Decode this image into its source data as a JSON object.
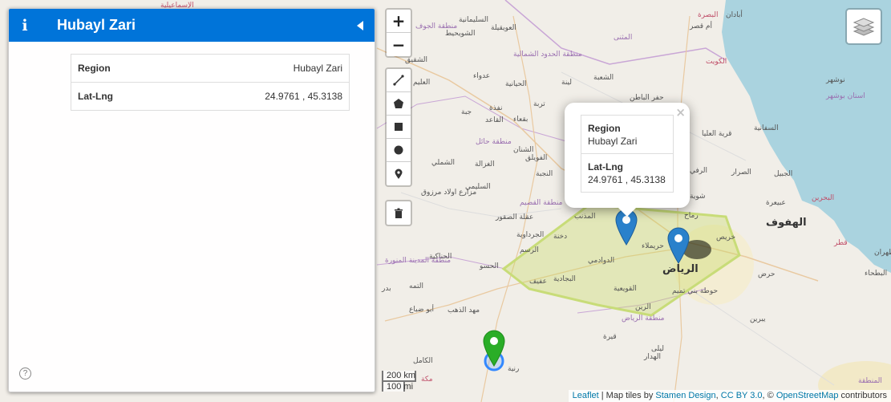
{
  "sidebar": {
    "title": "Hubayl Zari",
    "rows": [
      {
        "key": "Region",
        "value": "Hubayl Zari"
      },
      {
        "key": "Lat-Lng",
        "value": "24.9761 , 45.3138"
      }
    ],
    "help_glyph": "?",
    "info_glyph": "i"
  },
  "zoom": {
    "in": "+",
    "out": "−"
  },
  "draw_tools": [
    "polyline-icon",
    "polygon-icon",
    "rectangle-icon",
    "circle-icon",
    "marker-icon"
  ],
  "popup": {
    "close": "×",
    "rows": [
      {
        "key": "Region",
        "value": "Hubayl Zari"
      },
      {
        "key": "Lat-Lng",
        "value": "24.9761 , 45.3138"
      }
    ]
  },
  "scale": {
    "km": "200 km",
    "mi": "100 mi"
  },
  "attribution": {
    "leaflet": "Leaflet",
    "sep1": " | Map tiles by ",
    "stamen": "Stamen Design",
    "sep2": ", ",
    "cc": "CC BY 3.0",
    "sep3": ", © ",
    "osm": "OpenStreetMap",
    "sep4": " contributors"
  },
  "places": [
    {
      "name": "الإسماعيلية",
      "style": "red"
    },
    {
      "name": "الكويت",
      "style": "red"
    },
    {
      "name": "البصرة",
      "style": "red"
    },
    {
      "name": "المثنى",
      "style": "purple"
    },
    {
      "name": "منطقة الحدود الشمالية",
      "style": "purple"
    },
    {
      "name": "السليمانية",
      "style": ""
    },
    {
      "name": "الشويحيط",
      "style": ""
    },
    {
      "name": "العويقيلة",
      "style": ""
    },
    {
      "name": "منطقة الجوف",
      "style": "purple"
    },
    {
      "name": "الشقيق",
      "style": ""
    },
    {
      "name": "عدواء",
      "style": ""
    },
    {
      "name": "العليم",
      "style": ""
    },
    {
      "name": "الحيانية",
      "style": ""
    },
    {
      "name": "لينة",
      "style": ""
    },
    {
      "name": "الشعبة",
      "style": ""
    },
    {
      "name": "حفر الباطن",
      "style": ""
    },
    {
      "name": "نفذة",
      "style": ""
    },
    {
      "name": "تربة",
      "style": ""
    },
    {
      "name": "جبة",
      "style": ""
    },
    {
      "name": "بقعاء",
      "style": ""
    },
    {
      "name": "القاعد",
      "style": ""
    },
    {
      "name": "منطقة حائل",
      "style": "purple"
    },
    {
      "name": "الشنان",
      "style": ""
    },
    {
      "name": "الشملي",
      "style": ""
    },
    {
      "name": "الغزالة",
      "style": ""
    },
    {
      "name": "الفويلق",
      "style": ""
    },
    {
      "name": "النجبة",
      "style": ""
    },
    {
      "name": "السليمي",
      "style": ""
    },
    {
      "name": "مزارع اولاد مرزوق",
      "style": ""
    },
    {
      "name": "منطقة القصيم",
      "style": "purple"
    },
    {
      "name": "عقلة الصقور",
      "style": ""
    },
    {
      "name": "المذنب",
      "style": ""
    },
    {
      "name": "الجرداوية",
      "style": ""
    },
    {
      "name": "دخنة",
      "style": ""
    },
    {
      "name": "الرسم",
      "style": ""
    },
    {
      "name": "الحناكية",
      "style": ""
    },
    {
      "name": "الدوادمي",
      "style": ""
    },
    {
      "name": "الحسو",
      "style": ""
    },
    {
      "name": "البجادية",
      "style": ""
    },
    {
      "name": "عفيف",
      "style": ""
    },
    {
      "name": "منطقة المدينة المنورة",
      "style": "purple"
    },
    {
      "name": "التمه",
      "style": ""
    },
    {
      "name": "بدر",
      "style": ""
    },
    {
      "name": "مهد الذهب",
      "style": ""
    },
    {
      "name": "أبو ضباع",
      "style": ""
    },
    {
      "name": "القويعية",
      "style": ""
    },
    {
      "name": "الرين",
      "style": ""
    },
    {
      "name": "منطقة الرياض",
      "style": "purple"
    },
    {
      "name": "الرياض",
      "style": "big"
    },
    {
      "name": "حريملاء",
      "style": ""
    },
    {
      "name": "حوطة بني تميم",
      "style": ""
    },
    {
      "name": "مكة",
      "style": "red"
    },
    {
      "name": "الكامل",
      "style": ""
    },
    {
      "name": "رنية",
      "style": ""
    },
    {
      "name": "قيرة",
      "style": ""
    },
    {
      "name": "ليلى",
      "style": ""
    },
    {
      "name": "الهدار",
      "style": ""
    },
    {
      "name": "يبرين",
      "style": ""
    },
    {
      "name": "حرض",
      "style": ""
    },
    {
      "name": "البطحاء",
      "style": ""
    },
    {
      "name": "خريص",
      "style": ""
    },
    {
      "name": "الهفوف",
      "style": "big"
    },
    {
      "name": "البحرين",
      "style": "red"
    },
    {
      "name": "قطر",
      "style": "red"
    },
    {
      "name": "الظهران",
      "style": ""
    },
    {
      "name": "الجبيل",
      "style": ""
    },
    {
      "name": "الصرار",
      "style": ""
    },
    {
      "name": "السفانية",
      "style": ""
    },
    {
      "name": "قرية العليا",
      "style": ""
    },
    {
      "name": "عبيعرة",
      "style": ""
    },
    {
      "name": "نوشهر",
      "style": ""
    },
    {
      "name": "استان بوشهر",
      "style": "purple"
    },
    {
      "name": "أبادان",
      "style": ""
    },
    {
      "name": "أم قصر",
      "style": ""
    },
    {
      "name": "رماح",
      "style": ""
    },
    {
      "name": "شوية",
      "style": ""
    },
    {
      "name": "الرفي",
      "style": ""
    },
    {
      "name": "المنطقة",
      "style": "purple"
    }
  ]
}
